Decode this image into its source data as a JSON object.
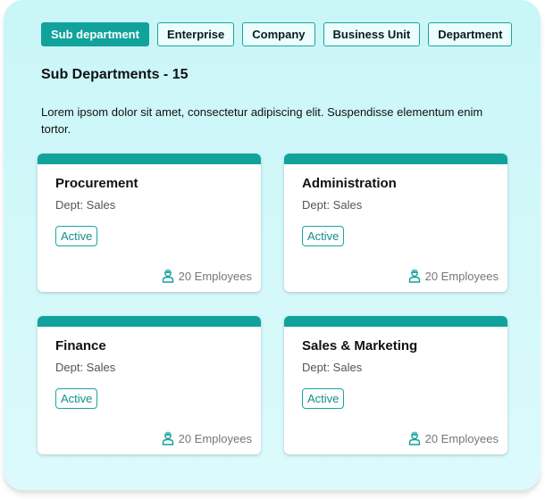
{
  "tabs": [
    {
      "label": "Sub department",
      "active": true
    },
    {
      "label": "Enterprise",
      "active": false
    },
    {
      "label": "Company",
      "active": false
    },
    {
      "label": "Business Unit",
      "active": false
    },
    {
      "label": "Department",
      "active": false
    }
  ],
  "heading": "Sub Departments - 15",
  "description": "Lorem ipsom dolor sit amet, consectetur adipiscing elit. Suspendisse elementum enim tortor.",
  "cards": [
    {
      "title": "Procurement",
      "dept": "Dept: Sales",
      "status": "Active",
      "employees": "20 Employees"
    },
    {
      "title": "Administration",
      "dept": "Dept: Sales",
      "status": "Active",
      "employees": "20 Employees"
    },
    {
      "title": "Finance",
      "dept": "Dept: Sales",
      "status": "Active",
      "employees": "20 Employees"
    },
    {
      "title": "Sales & Marketing",
      "dept": "Dept: Sales",
      "status": "Active",
      "employees": "20 Employees"
    }
  ],
  "colors": {
    "accent": "#11a29c",
    "panel_background": "#d1f8f9",
    "card_background": "#ffffff"
  },
  "icons": {
    "employees": "employee-icon"
  }
}
